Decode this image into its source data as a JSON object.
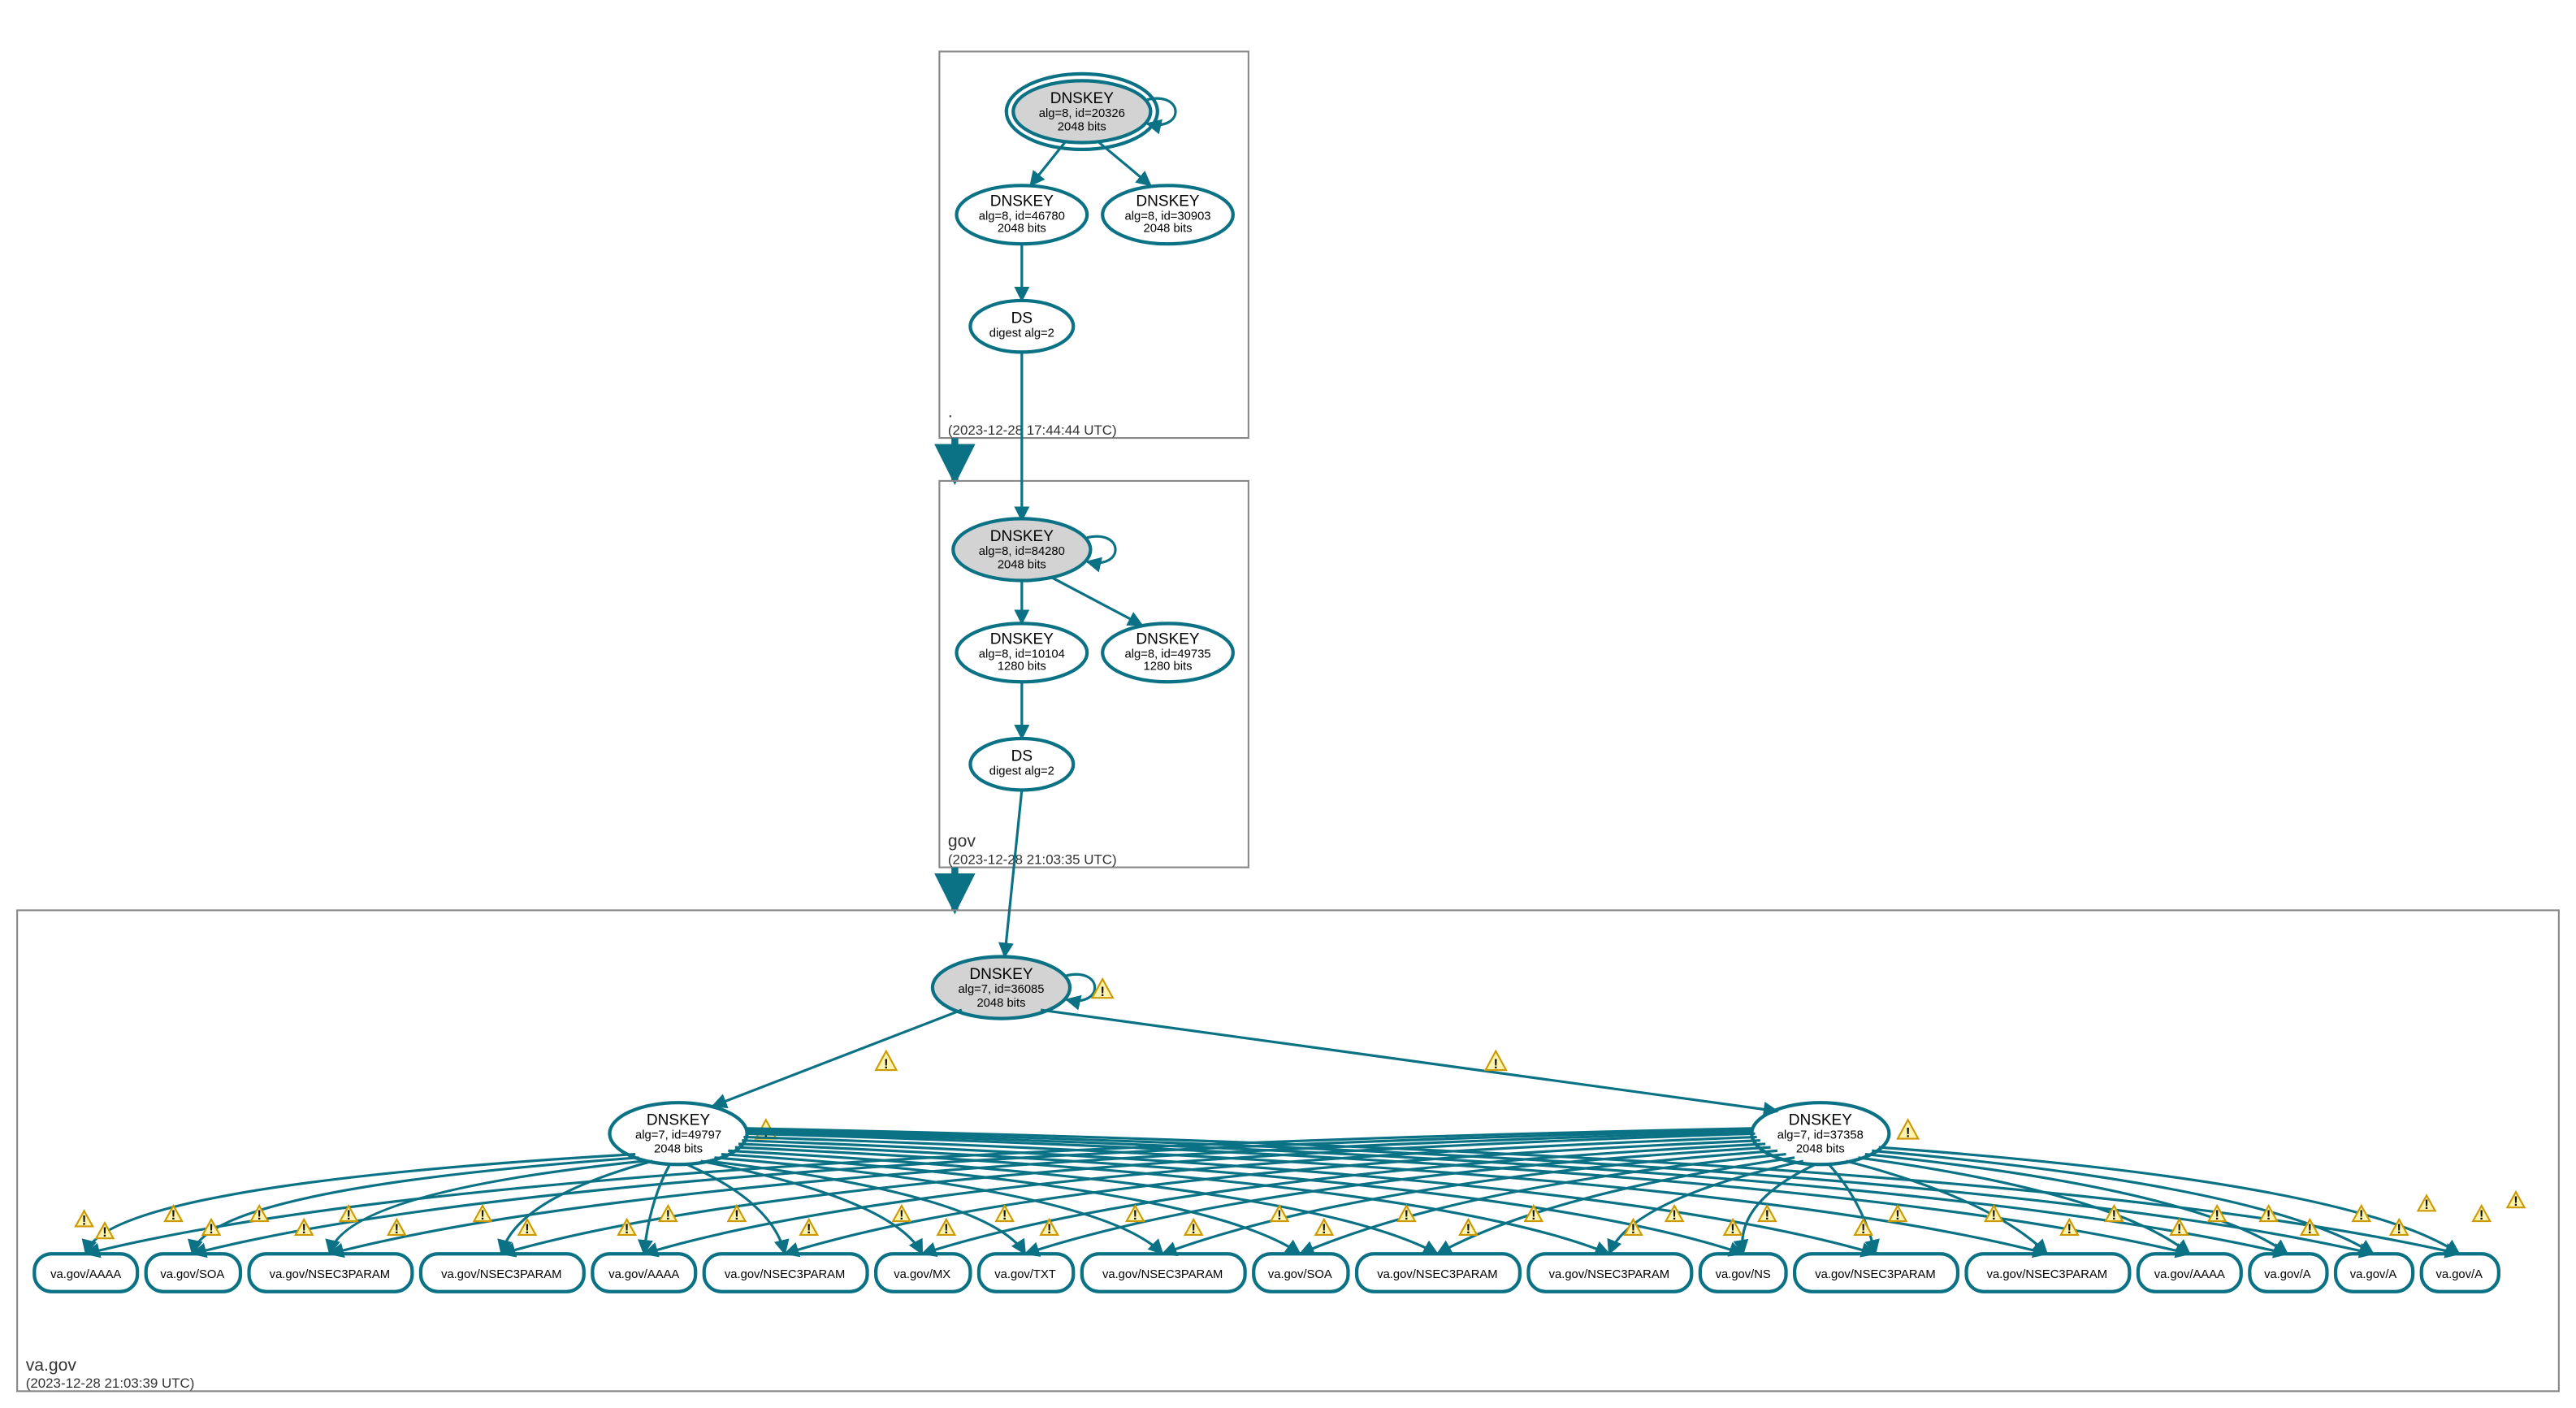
{
  "zones": {
    "root": {
      "label": ".",
      "timestamp": "(2023-12-28 17:44:44 UTC)"
    },
    "gov": {
      "label": "gov",
      "timestamp": "(2023-12-28 21:03:35 UTC)"
    },
    "vagov": {
      "label": "va.gov",
      "timestamp": "(2023-12-28 21:03:39 UTC)"
    }
  },
  "nodes": {
    "root_ksk": {
      "title": "DNSKEY",
      "l1": "alg=8, id=20326",
      "l2": "2048 bits"
    },
    "root_zsk1": {
      "title": "DNSKEY",
      "l1": "alg=8, id=46780",
      "l2": "2048 bits"
    },
    "root_zsk2": {
      "title": "DNSKEY",
      "l1": "alg=8, id=30903",
      "l2": "2048 bits"
    },
    "root_ds": {
      "title": "DS",
      "l1": "digest alg=2"
    },
    "gov_ksk": {
      "title": "DNSKEY",
      "l1": "alg=8, id=84280",
      "l2": "2048 bits"
    },
    "gov_zsk1": {
      "title": "DNSKEY",
      "l1": "alg=8, id=10104",
      "l2": "1280 bits"
    },
    "gov_zsk2": {
      "title": "DNSKEY",
      "l1": "alg=8, id=49735",
      "l2": "1280 bits"
    },
    "gov_ds": {
      "title": "DS",
      "l1": "digest alg=2"
    },
    "vagov_ksk": {
      "title": "DNSKEY",
      "l1": "alg=7, id=36085",
      "l2": "2048 bits"
    },
    "vagov_zsk1": {
      "title": "DNSKEY",
      "l1": "alg=7, id=49797",
      "l2": "2048 bits"
    },
    "vagov_zsk2": {
      "title": "DNSKEY",
      "l1": "alg=7, id=37358",
      "l2": "2048 bits"
    }
  },
  "rrs": {
    "r0": "va.gov/AAAA",
    "r1": "va.gov/SOA",
    "r2": "va.gov/NSEC3PARAM",
    "r3": "va.gov/NSEC3PARAM",
    "r4": "va.gov/AAAA",
    "r5": "va.gov/NSEC3PARAM",
    "r6": "va.gov/MX",
    "r7": "va.gov/TXT",
    "r8": "va.gov/NSEC3PARAM",
    "r9": "va.gov/SOA",
    "r10": "va.gov/NSEC3PARAM",
    "r11": "va.gov/NSEC3PARAM",
    "r12": "va.gov/NS",
    "r13": "va.gov/NSEC3PARAM",
    "r14": "va.gov/NSEC3PARAM",
    "r15": "va.gov/AAAA",
    "r16": "va.gov/A",
    "r17": "va.gov/A",
    "r18": "va.gov/A"
  }
}
